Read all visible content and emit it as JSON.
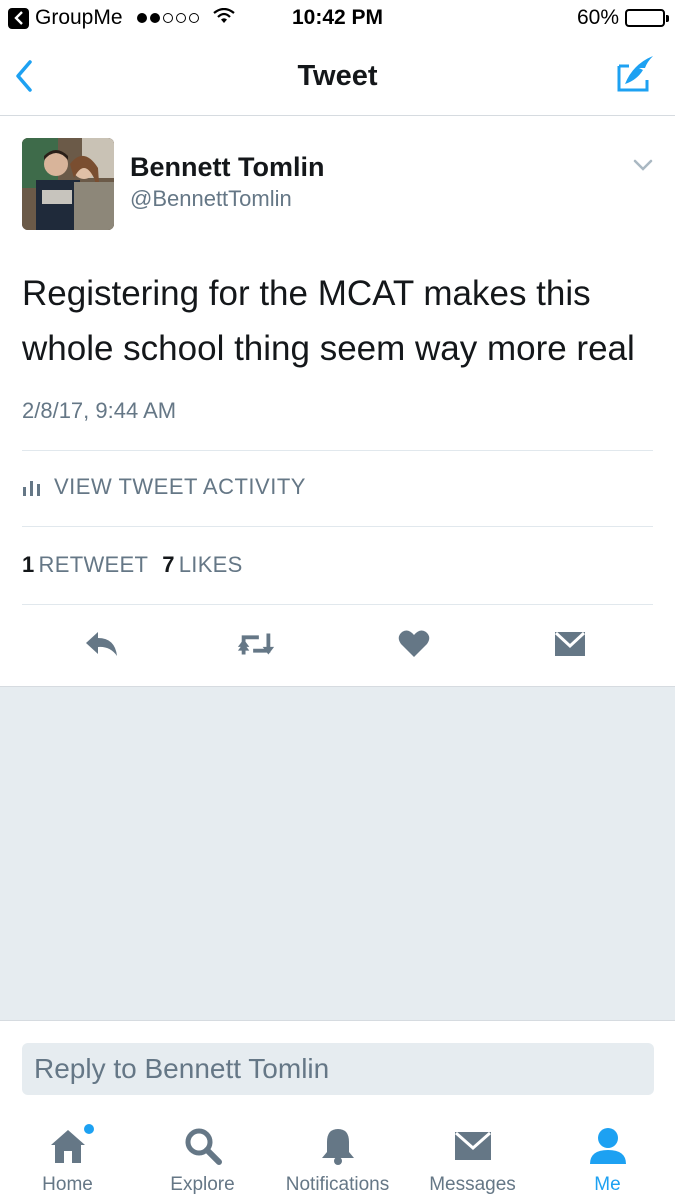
{
  "status_bar": {
    "back_app": "GroupMe",
    "time": "10:42 PM",
    "battery": "60%",
    "battery_level": 0.6
  },
  "nav": {
    "title": "Tweet",
    "back_icon": "chevron-left-icon",
    "compose_icon": "compose-icon"
  },
  "tweet": {
    "author_name": "Bennett Tomlin",
    "author_handle": "@BennettTomlin",
    "text": "Registering for the MCAT makes this whole school thing seem way more real",
    "timestamp": "2/8/17, 9:44 AM",
    "activity_label": "VIEW TWEET ACTIVITY",
    "retweet_count": "1",
    "retweet_label": "RETWEET",
    "like_count": "7",
    "like_label": "LIKES"
  },
  "reply": {
    "placeholder": "Reply to Bennett Tomlin"
  },
  "tabs": [
    {
      "label": "Home",
      "icon": "home-icon",
      "active": false,
      "badge": true
    },
    {
      "label": "Explore",
      "icon": "search-icon",
      "active": false
    },
    {
      "label": "Notifications",
      "icon": "bell-icon",
      "active": false
    },
    {
      "label": "Messages",
      "icon": "envelope-icon",
      "active": false
    },
    {
      "label": "Me",
      "icon": "person-icon",
      "active": true
    }
  ],
  "colors": {
    "accent": "#1da1f2",
    "secondary_text": "#657786",
    "background_gray": "#e6ecf0"
  }
}
